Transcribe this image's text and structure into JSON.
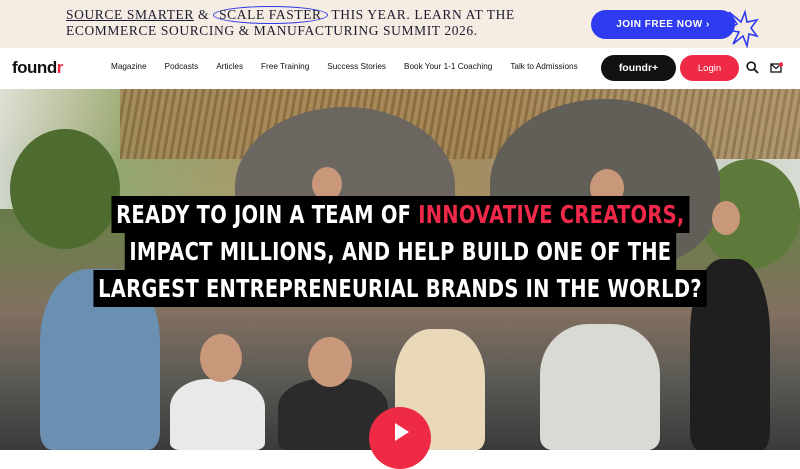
{
  "banner": {
    "part1": "SOURCE SMARTER",
    "amp": " & ",
    "part2": "SCALE FASTER",
    "part3": " THIS YEAR. LEARN AT THE",
    "line2": "ECOMMERCE SOURCING & MANUFACTURING SUMMIT 2026.",
    "cta": "JOIN FREE NOW ›"
  },
  "nav": {
    "logo_main": "found",
    "logo_accent": "r",
    "links": [
      "Magazine",
      "Podcasts",
      "Articles",
      "Free Training",
      "Success Stories",
      "Book Your 1-1 Coaching",
      "Talk to Admissions"
    ],
    "foundr_plus": "foundr+",
    "login": "Login"
  },
  "hero": {
    "line1_a": "READY TO JOIN A TEAM OF ",
    "line1_b": "INNOVATIVE CREATORS,",
    "line2": "IMPACT MILLIONS, AND HELP BUILD ONE OF THE",
    "line3": "LARGEST ENTREPRENEURIAL BRANDS IN THE WORLD?"
  },
  "colors": {
    "accent": "#ef2a45",
    "brand_blue": "#2e3bf0",
    "banner_bg": "#f5ece3"
  },
  "icons": [
    "burst-icon",
    "search-icon",
    "mail-icon",
    "play-icon"
  ]
}
